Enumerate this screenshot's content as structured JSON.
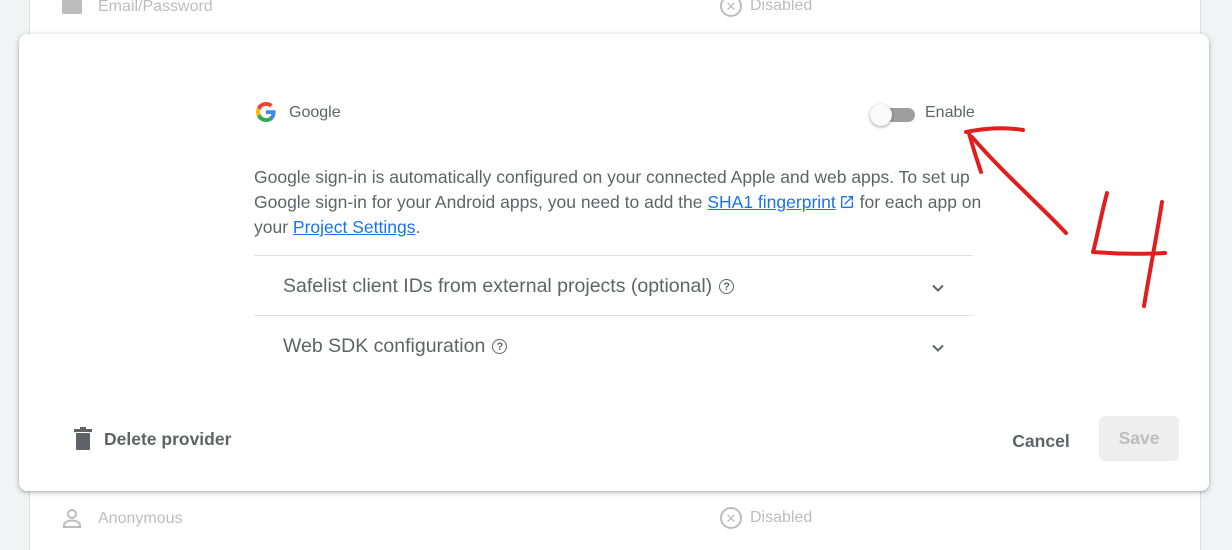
{
  "background_list": {
    "top_row": {
      "provider": "Email/Password",
      "status": "Disabled"
    },
    "bottom_row": {
      "provider": "Anonymous",
      "status": "Disabled"
    }
  },
  "dialog": {
    "provider_name": "Google",
    "toggle_label": "Enable",
    "toggle_state": "off",
    "description": {
      "part1": "Google sign-in is automatically configured on your connected Apple and web apps. To set up Google sign-in for your Android apps, you need to add the ",
      "link1": "SHA1 fingerprint",
      "part2": " for each app on your ",
      "link2": "Project Settings",
      "part3": "."
    },
    "expanders": [
      {
        "title": "Safelist client IDs from external projects (optional)"
      },
      {
        "title": "Web SDK configuration"
      }
    ],
    "footer": {
      "delete_label": "Delete provider",
      "cancel_label": "Cancel",
      "save_label": "Save"
    }
  },
  "annotation": {
    "text": "4",
    "color": "#e11d1d"
  },
  "colors": {
    "link": "#1a73e8",
    "text": "#5f6368",
    "annotation": "#e11d1d"
  }
}
